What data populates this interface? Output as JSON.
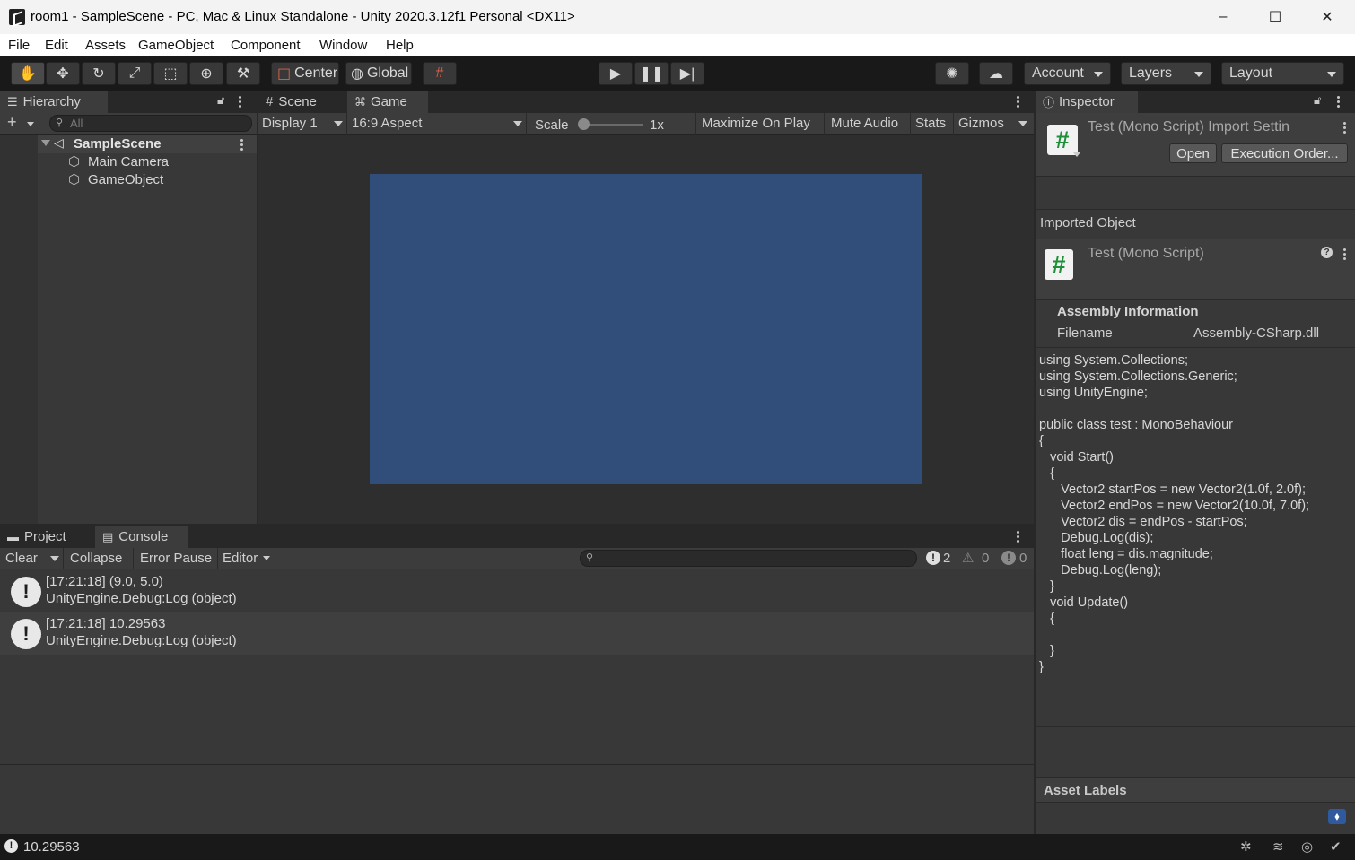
{
  "window": {
    "title": "room1 - SampleScene - PC, Mac & Linux Standalone - Unity 2020.3.12f1 Personal <DX11>",
    "minimize": "–",
    "maximize": "☐",
    "close": "✕"
  },
  "menu": [
    "File",
    "Edit",
    "Assets",
    "GameObject",
    "Component",
    "Window",
    "Help"
  ],
  "toolbar": {
    "tools": [
      "hand-tool",
      "move-tool",
      "rotate-tool",
      "scale-tool",
      "rect-tool",
      "transform-tool",
      "custom-tool"
    ],
    "pivot": "Center",
    "space": "Global",
    "account": "Account",
    "layers": "Layers",
    "layout": "Layout"
  },
  "hierarchy": {
    "tab": "Hierarchy",
    "add": "+",
    "search_placeholder": "All",
    "scene": "SampleScene",
    "items": [
      "Main Camera",
      "GameObject"
    ]
  },
  "game": {
    "tabs": [
      "Scene",
      "Game"
    ],
    "display": "Display 1",
    "aspect": "16:9 Aspect",
    "scale_label": "Scale",
    "scale_value": "1x",
    "maximize": "Maximize On Play",
    "mute": "Mute Audio",
    "stats": "Stats",
    "gizmos": "Gizmos",
    "viewport_color": "#314d79"
  },
  "console": {
    "tabs": [
      "Project",
      "Console"
    ],
    "clear": "Clear",
    "collapse": "Collapse",
    "error_pause": "Error Pause",
    "editor": "Editor",
    "counts": {
      "log": "2",
      "warn": "0",
      "error": "0"
    },
    "logs": [
      {
        "line1": "[17:21:18] (9.0, 5.0)",
        "line2": "UnityEngine.Debug:Log (object)"
      },
      {
        "line1": "[17:21:18] 10.29563",
        "line2": "UnityEngine.Debug:Log (object)"
      }
    ]
  },
  "inspector": {
    "tab": "Inspector",
    "header_title": "Test (Mono Script) Import Settin",
    "open": "Open",
    "execution_order": "Execution Order...",
    "imported_object": "Imported Object",
    "script_title": "Test (Mono Script)",
    "assembly_info": "Assembly Information",
    "filename_label": "Filename",
    "filename_value": "Assembly-CSharp.dll",
    "code": "using System.Collections;\nusing System.Collections.Generic;\nusing UnityEngine;\n\npublic class test : MonoBehaviour\n{\n   void Start()\n   {\n      Vector2 startPos = new Vector2(1.0f, 2.0f);\n      Vector2 endPos = new Vector2(10.0f, 7.0f);\n      Vector2 dis = endPos - startPos;\n      Debug.Log(dis);\n      float leng = dis.magnitude;\n      Debug.Log(leng);\n   }\n   void Update()\n   {\n\n   }\n}",
    "asset_labels": "Asset Labels"
  },
  "status": {
    "message": "10.29563"
  }
}
